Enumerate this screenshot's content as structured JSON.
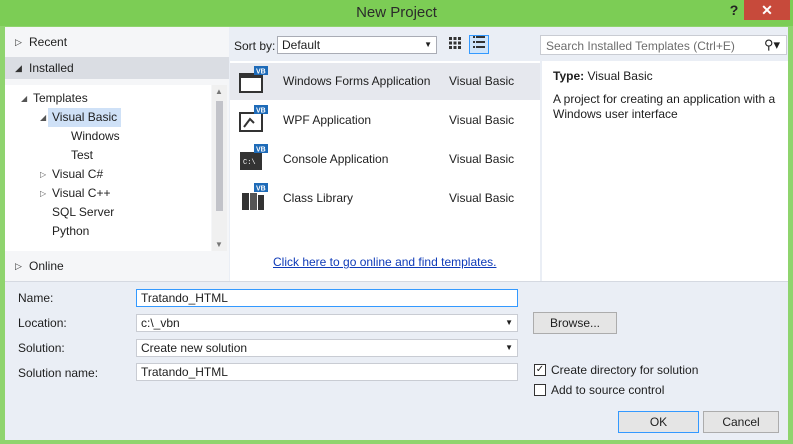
{
  "window": {
    "title": "New Project",
    "help_glyph": "?",
    "close_glyph": "✕"
  },
  "nav": {
    "recent": "Recent",
    "installed": "Installed",
    "online": "Online",
    "tree": {
      "templates": "Templates",
      "visual_basic": "Visual Basic",
      "windows": "Windows",
      "test": "Test",
      "visual_csharp": "Visual C#",
      "visual_cpp": "Visual C++",
      "sql_server": "SQL Server",
      "python": "Python"
    }
  },
  "sortbar": {
    "label": "Sort by:",
    "value": "Default",
    "search_placeholder": "Search Installed Templates (Ctrl+E)"
  },
  "templates": [
    {
      "name": "Windows Forms Application",
      "language": "Visual Basic",
      "icon": "windows-forms-icon"
    },
    {
      "name": "WPF Application",
      "language": "Visual Basic",
      "icon": "wpf-icon"
    },
    {
      "name": "Console Application",
      "language": "Visual Basic",
      "icon": "console-icon"
    },
    {
      "name": "Class Library",
      "language": "Visual Basic",
      "icon": "class-library-icon"
    }
  ],
  "online_link": "Click here to go online and find templates.",
  "description": {
    "type_label": "Type:",
    "type_value": "Visual Basic",
    "text": "A project for creating an application with a Windows user interface"
  },
  "form": {
    "name_label": "Name:",
    "name_value": "Tratando_HTML",
    "location_label": "Location:",
    "location_value": "c:\\_vbn",
    "solution_label": "Solution:",
    "solution_value": "Create new solution",
    "solution_name_label": "Solution name:",
    "solution_name_value": "Tratando_HTML",
    "browse": "Browse...",
    "create_dir": "Create directory for solution",
    "create_dir_checked": true,
    "source_control": "Add to source control",
    "source_control_checked": false,
    "ok": "OK",
    "cancel": "Cancel"
  },
  "colors": {
    "titlebar": "#7ccd55",
    "close": "#c74a3b",
    "link": "#0e3ab8",
    "accent": "#3399ff"
  }
}
